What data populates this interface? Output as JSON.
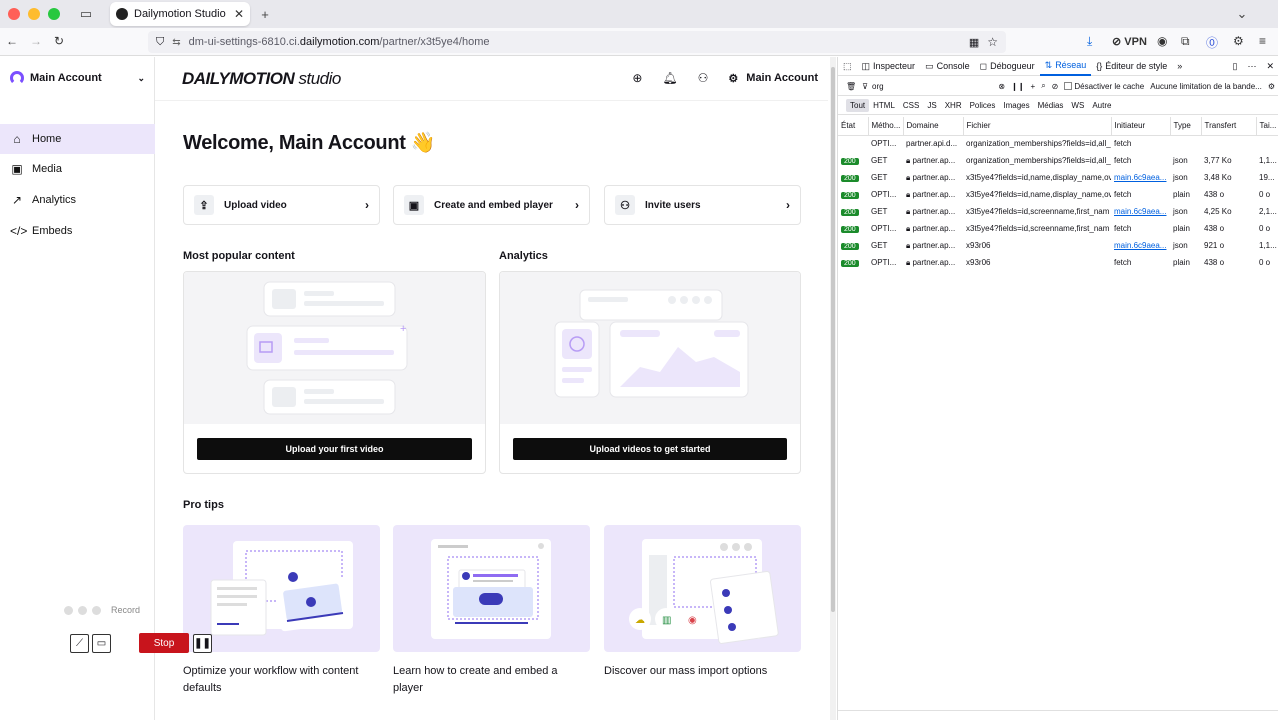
{
  "browser": {
    "tab_title": "Dailymotion Studio",
    "url_prefix": "dm-ui-settings-6810.ci.",
    "url_domain": "dailymotion.com",
    "url_path": "/partner/x3t5ye4/home",
    "vpn_label": "VPN"
  },
  "sidebar": {
    "account": "Main Account",
    "items": [
      {
        "label": "Home",
        "icon": "home-icon"
      },
      {
        "label": "Media",
        "icon": "media-icon"
      },
      {
        "label": "Analytics",
        "icon": "analytics-icon"
      },
      {
        "label": "Embeds",
        "icon": "embed-icon"
      }
    ]
  },
  "header": {
    "brand_main": "DAILYMOTION",
    "brand_sub": "studio",
    "account": "Main Account"
  },
  "main": {
    "welcome": "Welcome, Main Account 👋",
    "quick_actions": [
      "Upload video",
      "Create and embed player",
      "Invite users"
    ],
    "most_popular_title": "Most popular content",
    "analytics_title": "Analytics",
    "upload_first_btn": "Upload your first video",
    "upload_started_btn": "Upload videos to get started",
    "pro_tips_title": "Pro tips",
    "tips": [
      "Optimize your workflow with content defaults",
      "Learn how to create and embed a player",
      "Discover our mass import options"
    ]
  },
  "recorder": {
    "label": "Record",
    "stop": "Stop"
  },
  "devtools": {
    "tabs": [
      "Inspecteur",
      "Console",
      "Débogueur",
      "Réseau",
      "Éditeur de style"
    ],
    "filter_text": "org",
    "disable_cache": "Désactiver le cache",
    "throttle": "Aucune limitation de la bande...",
    "types": [
      "Tout",
      "HTML",
      "CSS",
      "JS",
      "XHR",
      "Polices",
      "Images",
      "Médias",
      "WS",
      "Autre"
    ],
    "columns": [
      "État",
      "Métho...",
      "Domaine",
      "Fichier",
      "Initiateur",
      "Type",
      "Transfert",
      "Tai..."
    ],
    "rows": [
      {
        "status": "",
        "method": "OPTI...",
        "domain": "partner.api.d...",
        "file": "organization_memberships?fields=id,all_",
        "initiator": "fetch",
        "type": "",
        "transfer": "",
        "size": ""
      },
      {
        "status": "200",
        "method": "GET",
        "domain": "partner.ap...",
        "file": "organization_memberships?fields=id,all_",
        "initiator": "fetch",
        "type": "json",
        "transfer": "3,77 Ko",
        "size": "1,1..."
      },
      {
        "status": "200",
        "method": "GET",
        "domain": "partner.ap...",
        "file": "x3t5ye4?fields=id,name,display_name,ov",
        "initiator": "main.6c9aea...",
        "type": "json",
        "transfer": "3,48 Ko",
        "size": "19..."
      },
      {
        "status": "200",
        "method": "OPTI...",
        "domain": "partner.ap...",
        "file": "x3t5ye4?fields=id,name,display_name,ov",
        "initiator": "fetch",
        "type": "plain",
        "transfer": "438 o",
        "size": "0 o"
      },
      {
        "status": "200",
        "method": "GET",
        "domain": "partner.ap...",
        "file": "x3t5ye4?fields=id,screenname,first_nam",
        "initiator": "main.6c9aea...",
        "type": "json",
        "transfer": "4,25 Ko",
        "size": "2,1..."
      },
      {
        "status": "200",
        "method": "OPTI...",
        "domain": "partner.ap...",
        "file": "x3t5ye4?fields=id,screenname,first_nam",
        "initiator": "fetch",
        "type": "plain",
        "transfer": "438 o",
        "size": "0 o"
      },
      {
        "status": "200",
        "method": "GET",
        "domain": "partner.ap...",
        "file": "x93r06",
        "initiator": "main.6c9aea...",
        "type": "json",
        "transfer": "921 o",
        "size": "1,1..."
      },
      {
        "status": "200",
        "method": "OPTI...",
        "domain": "partner.ap...",
        "file": "x93r06",
        "initiator": "fetch",
        "type": "plain",
        "transfer": "438 o",
        "size": "0 o"
      }
    ]
  },
  "colors": {
    "accent": "#7b4fff",
    "active_bg": "#ece6fb",
    "stop": "#c8141c",
    "network_blue": "#0060df"
  }
}
